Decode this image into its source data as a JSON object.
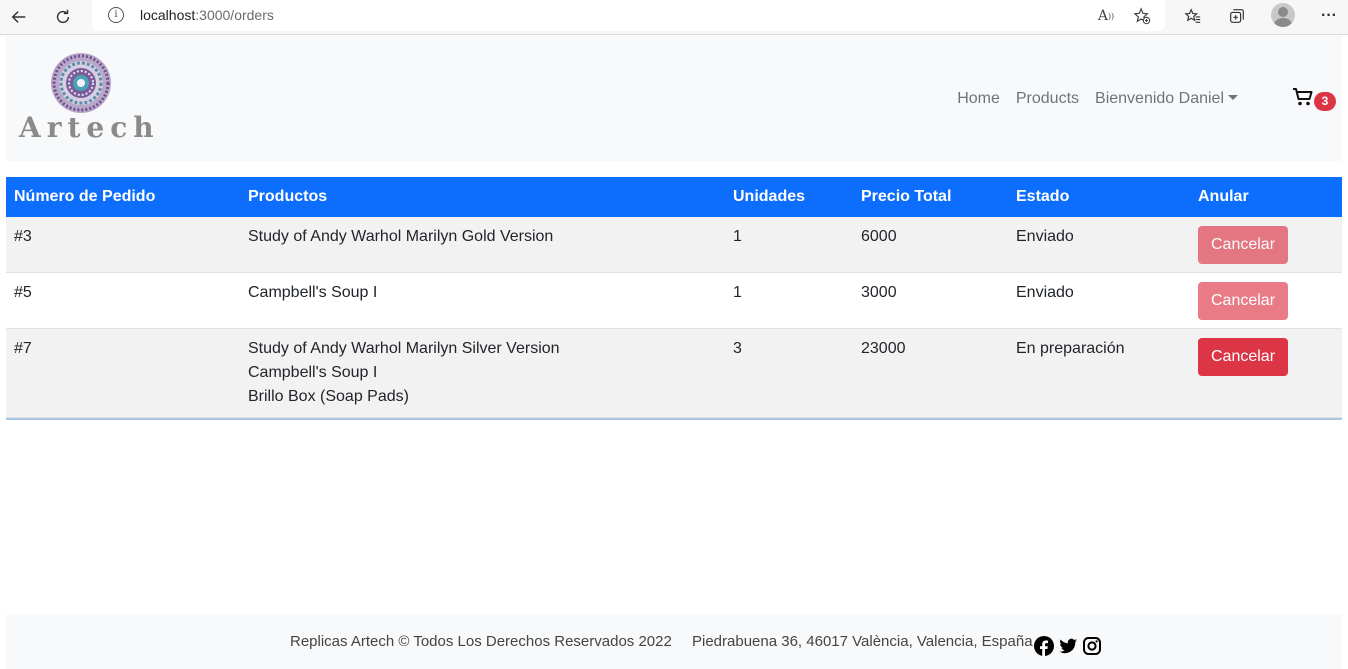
{
  "browser": {
    "url_host": "localhost",
    "url_path": ":3000/orders",
    "reader_label": "A",
    "menu_label": "···"
  },
  "navbar": {
    "brand": "Artech",
    "links": [
      {
        "label": "Home"
      },
      {
        "label": "Products"
      }
    ],
    "user_dropdown": "Bienvenido Daniel",
    "cart_count": "3"
  },
  "table": {
    "headers": [
      "Número de Pedido",
      "Productos",
      "Unidades",
      "Precio Total",
      "Estado",
      "Anular"
    ],
    "rows": [
      {
        "order": "#3",
        "products": [
          "Study of Andy Warhol Marilyn Gold Version"
        ],
        "units": "1",
        "total": "6000",
        "status": "Enviado",
        "action": "Cancelar",
        "enabled": false
      },
      {
        "order": "#5",
        "products": [
          "Campbell's Soup I"
        ],
        "units": "1",
        "total": "3000",
        "status": "Enviado",
        "action": "Cancelar",
        "enabled": false
      },
      {
        "order": "#7",
        "products": [
          "Study of Andy Warhol Marilyn Silver Version",
          "Campbell's Soup I",
          "Brillo Box (Soap Pads)"
        ],
        "units": "3",
        "total": "23000",
        "status": "En preparación",
        "action": "Cancelar",
        "enabled": true
      }
    ]
  },
  "footer": {
    "copyright": "Replicas Artech © Todos Los Derechos Reservados 2022",
    "address": "Piedrabuena 36, 46017 València, Valencia, España",
    "social_icons": [
      "facebook-icon",
      "twitter-icon",
      "instagram-icon"
    ]
  },
  "colors": {
    "primary": "#0d6efd",
    "danger": "#dc3545",
    "navbar_bg": "#f8f9fa"
  }
}
